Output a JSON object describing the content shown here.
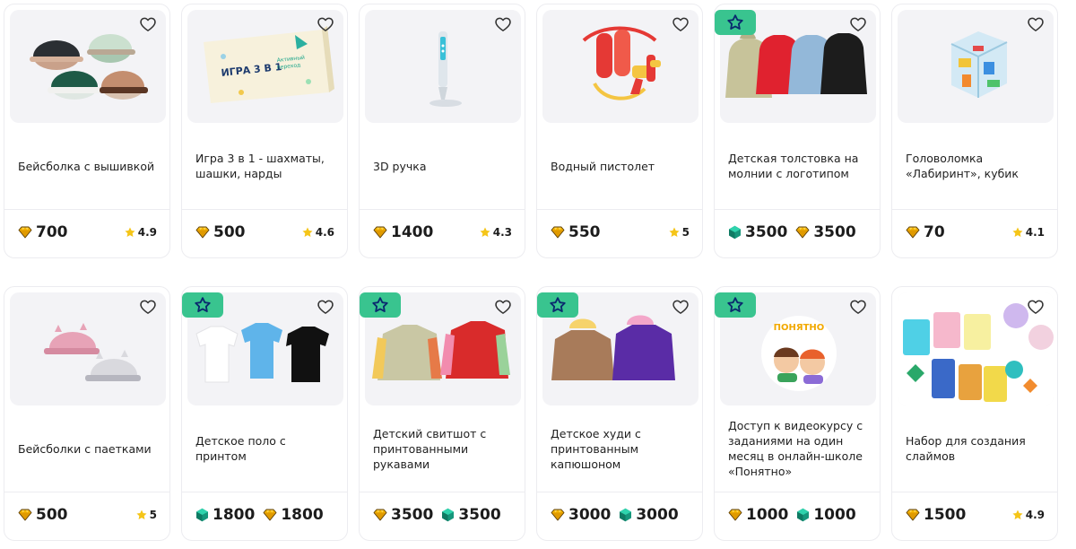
{
  "products": [
    {
      "title": "Бейсболка с вышивкой",
      "prices": [
        {
          "currency": "crystal-gold",
          "value": "700"
        }
      ],
      "rating": "4.9",
      "badge": false,
      "image": "caps-icon"
    },
    {
      "title": "Игра 3 в 1 - шахматы, шашки, нарды",
      "prices": [
        {
          "currency": "crystal-gold",
          "value": "500"
        }
      ],
      "rating": "4.6",
      "badge": false,
      "image": "game-box-icon",
      "box_text": "ИГРА 3 В 1",
      "box_sub": "Активный переход 10—ленно"
    },
    {
      "title": "3D ручка",
      "prices": [
        {
          "currency": "crystal-gold",
          "value": "1400"
        }
      ],
      "rating": "4.3",
      "badge": false,
      "image": "pen-3d-icon"
    },
    {
      "title": "Водный пистолет",
      "prices": [
        {
          "currency": "crystal-gold",
          "value": "550"
        }
      ],
      "rating": "5",
      "badge": false,
      "image": "water-gun-icon"
    },
    {
      "title": "Детская толстовка на молнии с логотипом",
      "prices": [
        {
          "currency": "crystal-teal",
          "value": "3500"
        },
        {
          "currency": "crystal-gold",
          "value": "3500"
        }
      ],
      "rating": "",
      "badge": true,
      "image": "hoodies-icon"
    },
    {
      "title": "Головоломка «Лабиринт», кубик",
      "prices": [
        {
          "currency": "crystal-gold",
          "value": "70"
        }
      ],
      "rating": "4.1",
      "badge": false,
      "image": "maze-cube-icon"
    },
    {
      "title": "Бейсболки с паетками",
      "prices": [
        {
          "currency": "crystal-gold",
          "value": "500"
        }
      ],
      "rating": "5",
      "badge": false,
      "image": "sequin-caps-icon"
    },
    {
      "title": "Детское поло с принтом",
      "prices": [
        {
          "currency": "crystal-teal",
          "value": "1800"
        },
        {
          "currency": "crystal-gold",
          "value": "1800"
        }
      ],
      "rating": "",
      "badge": true,
      "image": "polos-icon"
    },
    {
      "title": "Детский свитшот с принтованными рукавами",
      "prices": [
        {
          "currency": "crystal-gold",
          "value": "3500"
        },
        {
          "currency": "crystal-teal",
          "value": "3500"
        }
      ],
      "rating": "",
      "badge": true,
      "image": "sweatshirts-icon"
    },
    {
      "title": "Детское худи с принтованным капюшоном",
      "prices": [
        {
          "currency": "crystal-gold",
          "value": "3000"
        },
        {
          "currency": "crystal-teal",
          "value": "3000"
        }
      ],
      "rating": "",
      "badge": true,
      "image": "print-hoodies-icon"
    },
    {
      "title": "Доступ к видеокурсу с заданиями на один месяц в онлайн-школе «Понятно»",
      "prices": [
        {
          "currency": "crystal-gold",
          "value": "1000"
        },
        {
          "currency": "crystal-teal",
          "value": "1000"
        }
      ],
      "rating": "",
      "badge": true,
      "image": "course-logo-icon",
      "logo_text": "ПОНЯТНО"
    },
    {
      "title": "Набор для создания слаймов",
      "prices": [
        {
          "currency": "crystal-gold",
          "value": "1500"
        }
      ],
      "rating": "4.9",
      "badge": false,
      "image": "slime-kit-icon"
    }
  ],
  "colors": {
    "gold": "#f4b400",
    "teal": "#1aa58a",
    "badge": "#39c48f",
    "star": "#f5c518"
  }
}
